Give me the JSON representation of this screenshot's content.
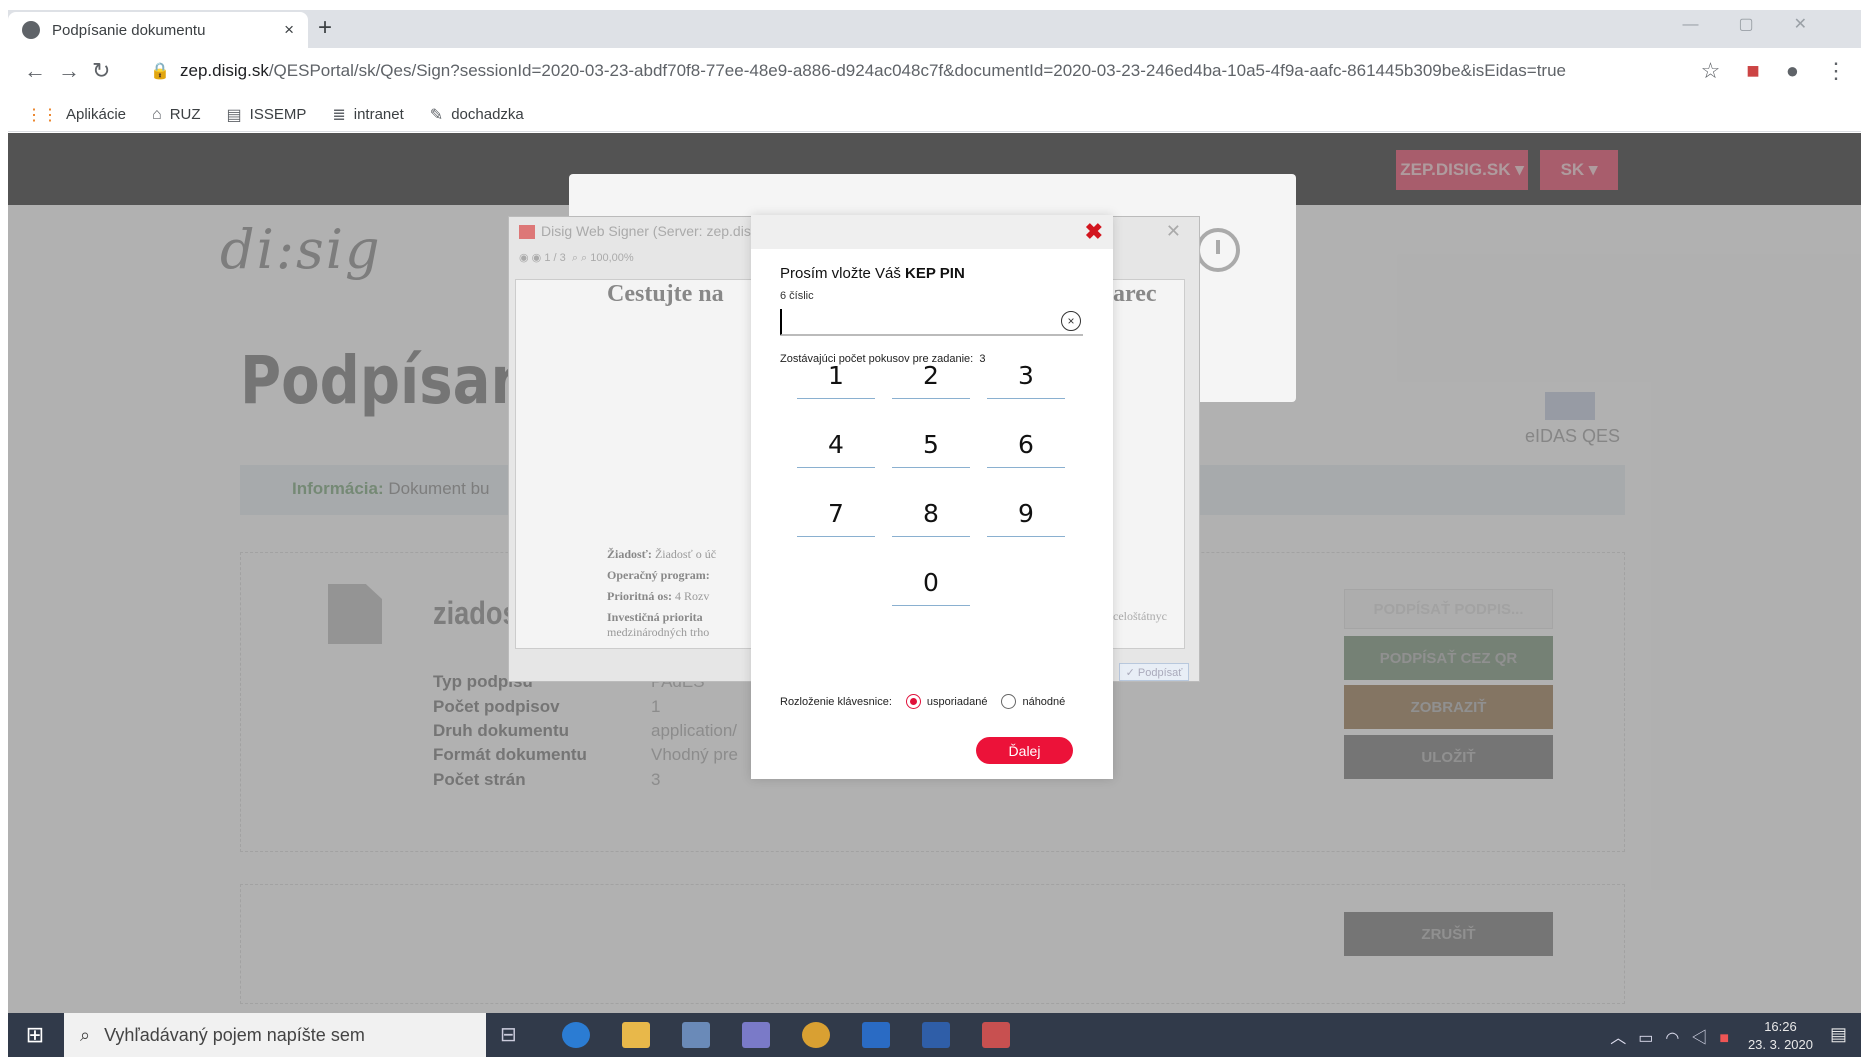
{
  "browser": {
    "tab_title": "Podpísanie dokumentu",
    "tab_close": "×",
    "new_tab": "+",
    "url_host": "zep.disig.sk",
    "url_rest": "/QESPortal/sk/Qes/Sign?sessionId=2020-03-23-abdf70f8-77ee-48e9-a886-d924ac048c7f&documentId=2020-03-23-246ed4ba-10a5-4f9a-aafc-861445b309be&isEidas=true",
    "bookmarks": [
      {
        "label": "Aplikácie",
        "icon": "apps-grid-icon"
      },
      {
        "label": "RUZ",
        "icon": "ruz-icon"
      },
      {
        "label": "ISSEMP",
        "icon": "document-icon"
      },
      {
        "label": "intranet",
        "icon": "intranet-icon"
      },
      {
        "label": "dochadzka",
        "icon": "dochadzka-icon"
      }
    ]
  },
  "page": {
    "header_btn_site": "ZEP.DISIG.SK ▾",
    "header_btn_lang": "SK ▾",
    "logo": "di:sig",
    "title": "Podpísanie d",
    "info_label": "Informácia:",
    "info_text": "Dokument bu",
    "eidas": "eIDAS QES",
    "file_name": "ziados",
    "meta": [
      {
        "label": "Typ podpisu",
        "value": "PAdES"
      },
      {
        "label": "Počet podpisov",
        "value": "1"
      },
      {
        "label": "Druh dokumentu",
        "value": "application/"
      },
      {
        "label": "Formát dokumentu",
        "value": "Vhodný pre"
      },
      {
        "label": "Počet strán",
        "value": "3"
      }
    ],
    "buttons": {
      "qr": "PODPÍSAŤ CEZ QR",
      "view": "ZOBRAZIŤ",
      "save": "ULOŽIŤ",
      "cancel": "ZRUŠIŤ",
      "sign_placeholder": "PODPÍSAŤ PODPIS..."
    }
  },
  "signer": {
    "title": "Disig Web Signer (Server: zep.dis",
    "page_indicator": "1 / 3",
    "zoom": "100,00%",
    "doc_heading_left": "Cestujte na",
    "doc_heading_right": "arec",
    "doc_lines": [
      {
        "label": "Žiadosť:",
        "text": "Žiadosť o úč"
      },
      {
        "label": "Operačný program:",
        "text": ""
      },
      {
        "label": "Prioritná os:",
        "text": "4 Rozv"
      },
      {
        "label": "Investičná priorita",
        "text": ""
      },
      {
        "label": "",
        "text": "medzinárodných trho"
      }
    ],
    "doc_right_text": "celoštátnyc",
    "sign_button": "✓ Podpísať"
  },
  "pin_dialog": {
    "close": "✖",
    "title_prefix": "Prosím vložte Váš ",
    "title_bold": "KEP PIN",
    "hint": "6 číslic",
    "value": "",
    "clear": "×",
    "attempts_label": "Zostávajúci počet pokusov pre zadanie:",
    "attempts": "3",
    "keys": [
      "1",
      "2",
      "3",
      "4",
      "5",
      "6",
      "7",
      "8",
      "9",
      "0"
    ],
    "layout_label": "Rozloženie klávesnice:",
    "layout_ordered": "usporiadané",
    "layout_random": "náhodné",
    "next": "Ďalej"
  },
  "taskbar": {
    "search_placeholder": "Vyhľadávaný pojem napíšte sem",
    "time": "16:26",
    "date": "23. 3. 2020"
  },
  "colors": {
    "accent_red": "#ec1239",
    "close_red": "#d2151e",
    "taskbar": "#313a4a"
  }
}
